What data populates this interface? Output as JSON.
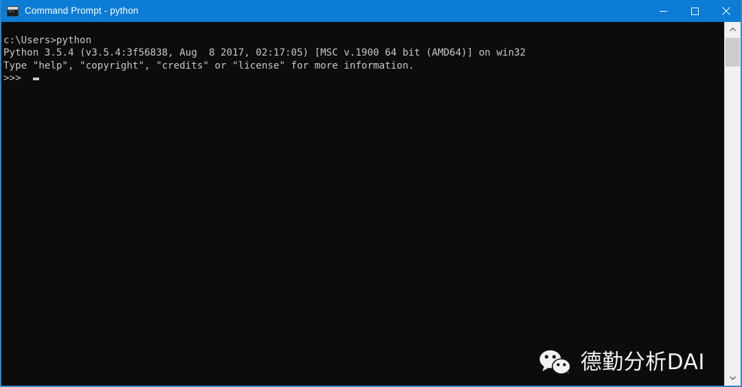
{
  "window": {
    "title": "Command Prompt - python",
    "icon": "command-prompt-icon",
    "icon_glyph": "C:\\",
    "accent_color": "#0c7cd5",
    "console_background": "#0c0c0c",
    "console_foreground": "#c8c8c8"
  },
  "window_controls": {
    "minimize": "Minimize",
    "maximize": "Maximize",
    "close": "Close"
  },
  "console": {
    "lines": [
      "c:\\Users>python",
      "Python 3.5.4 (v3.5.4:3f56838, Aug  8 2017, 02:17:05) [MSC v.1900 64 bit (AMD64)] on win32",
      "Type \"help\", \"copyright\", \"credits\" or \"license\" for more information."
    ],
    "prompt": ">>> ",
    "cursor": "block-caret"
  },
  "scrollbar": {
    "up_arrow": "scroll-up-arrow",
    "down_arrow": "scroll-down-arrow",
    "thumb": "scroll-thumb"
  },
  "watermark": {
    "logo": "wechat-logo",
    "text": "德勤分析DAI"
  }
}
